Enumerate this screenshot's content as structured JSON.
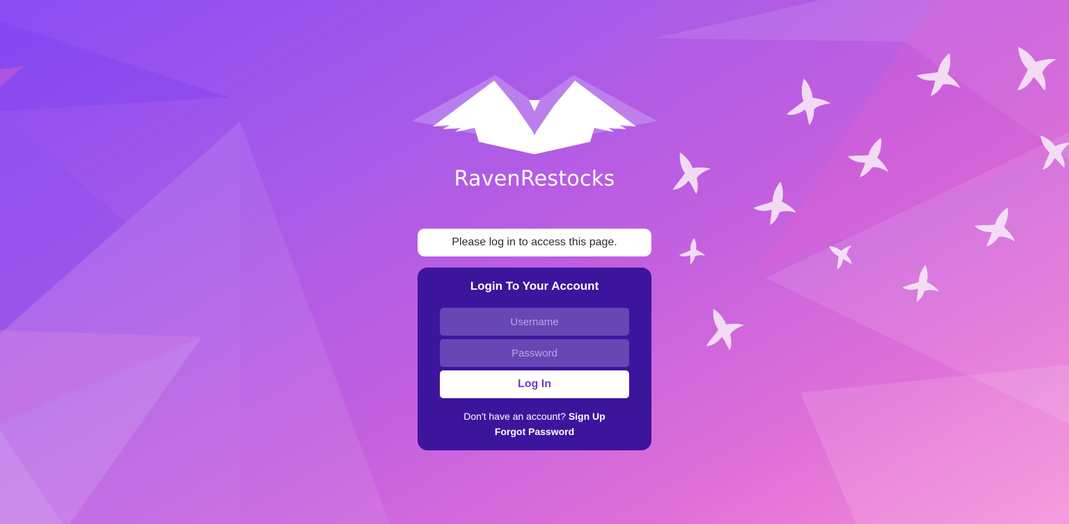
{
  "brand": {
    "name": "RavenRestocks",
    "logo_icon": "raven-wings-logo"
  },
  "notice": {
    "text": "Please log in to access this page."
  },
  "login": {
    "title": "Login To Your Account",
    "username_placeholder": "Username",
    "username_value": "",
    "password_placeholder": "Password",
    "password_value": "",
    "submit_label": "Log In",
    "signup_prompt": "Don't have an account?",
    "signup_label": "Sign Up",
    "forgot_label": "Forgot Password"
  },
  "colors": {
    "card_background": "#3d159c",
    "input_background": "#6747b4",
    "button_text": "#6a3ad0",
    "background_start": "#8a4cf3",
    "background_end": "#f58fd9"
  },
  "decorations": {
    "background": "geometric-triangles",
    "bird_icon": "flying-bird-icon"
  }
}
